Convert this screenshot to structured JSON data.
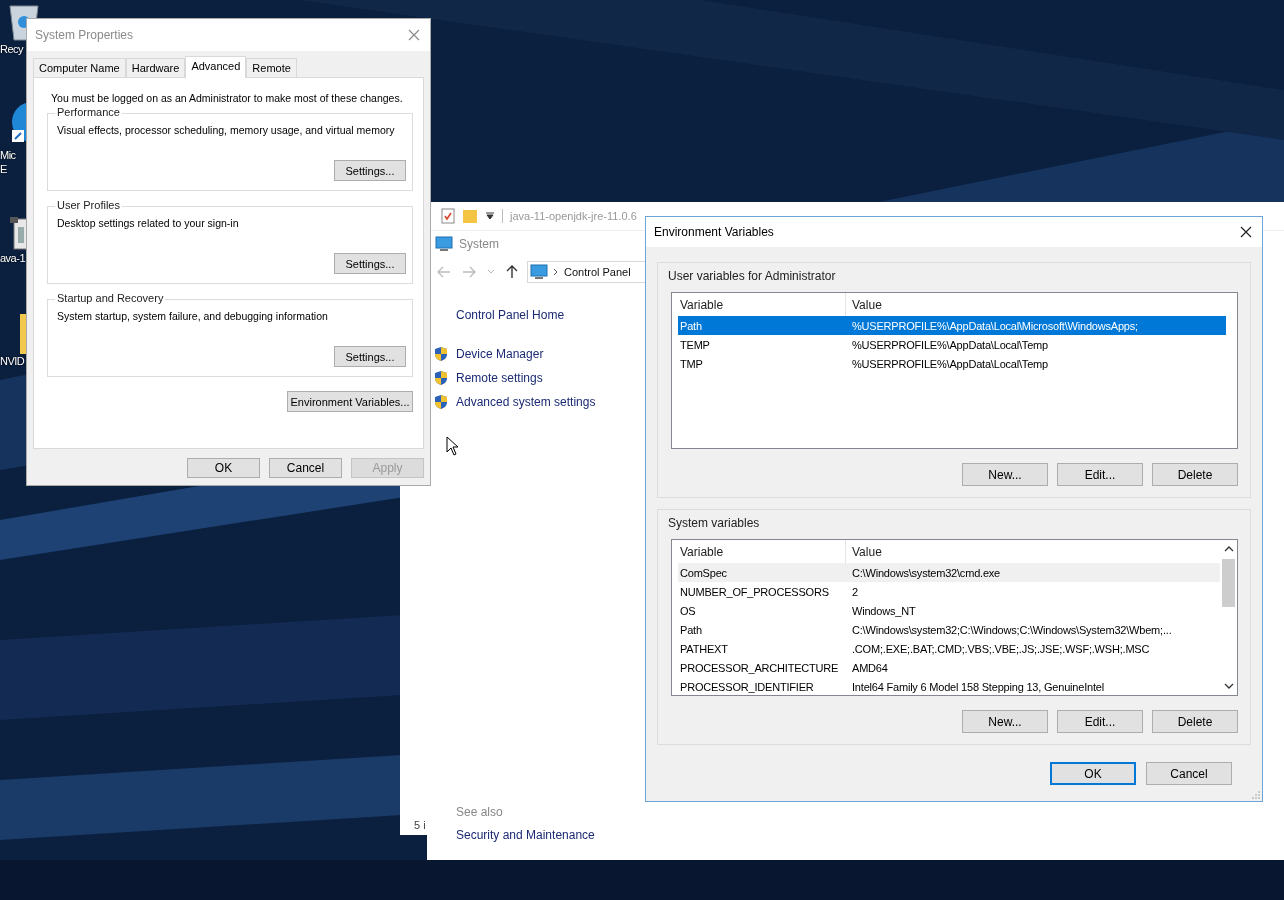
{
  "desktop": {
    "icons": [
      {
        "kind": "recycle",
        "lines": [
          "Recy"
        ]
      },
      {
        "kind": "browser",
        "lines": [
          "Mic",
          "E"
        ]
      },
      {
        "kind": "archive",
        "lines": [
          "ava-1"
        ]
      },
      {
        "kind": "folder",
        "lines": [
          "NVID"
        ]
      }
    ]
  },
  "back_window": {
    "status": "5 i"
  },
  "explorer": {
    "title": "java-11-openjdk-jre-11.0.6",
    "window_title": "System",
    "breadcrumb": "Control Panel",
    "home_link": "Control Panel Home",
    "links": [
      "Device Manager",
      "Remote settings",
      "Advanced system settings"
    ],
    "see_also": "See also",
    "see_also_links": [
      "Security and Maintenance"
    ]
  },
  "system_properties": {
    "title": "System Properties",
    "tabs": [
      {
        "label": "Computer Name",
        "selected": false
      },
      {
        "label": "Hardware",
        "selected": false
      },
      {
        "label": "Advanced",
        "selected": true
      },
      {
        "label": "Remote",
        "selected": false
      }
    ],
    "notice": "You must be logged on as an Administrator to make most of these changes.",
    "groups": [
      {
        "title": "Performance",
        "description": "Visual effects, processor scheduling, memory usage, and virtual memory",
        "button": "Settings..."
      },
      {
        "title": "User Profiles",
        "description": "Desktop settings related to your sign-in",
        "button": "Settings..."
      },
      {
        "title": "Startup and Recovery",
        "description": "System startup, system failure, and debugging information",
        "button": "Settings..."
      }
    ],
    "env_button": "Environment Variables...",
    "buttons": [
      {
        "label": "OK",
        "disabled": false
      },
      {
        "label": "Cancel",
        "disabled": false
      },
      {
        "label": "Apply",
        "disabled": true
      }
    ]
  },
  "environment_variables": {
    "title": "Environment Variables",
    "sections": [
      {
        "title": "User variables for Administrator",
        "focused": true,
        "scrollbar": false,
        "columns": [
          "Variable",
          "Value"
        ],
        "rows": [
          {
            "variable": "Path",
            "value": "%USERPROFILE%\\AppData\\Local\\Microsoft\\WindowsApps;",
            "selected": true
          },
          {
            "variable": "TEMP",
            "value": "%USERPROFILE%\\AppData\\Local\\Temp",
            "selected": false
          },
          {
            "variable": "TMP",
            "value": "%USERPROFILE%\\AppData\\Local\\Temp",
            "selected": false
          }
        ],
        "buttons": [
          "New...",
          "Edit...",
          "Delete"
        ]
      },
      {
        "title": "System variables",
        "focused": false,
        "scrollbar": true,
        "columns": [
          "Variable",
          "Value"
        ],
        "rows": [
          {
            "variable": "ComSpec",
            "value": "C:\\Windows\\system32\\cmd.exe",
            "selected": true
          },
          {
            "variable": "NUMBER_OF_PROCESSORS",
            "value": "2",
            "selected": false
          },
          {
            "variable": "OS",
            "value": "Windows_NT",
            "selected": false
          },
          {
            "variable": "Path",
            "value": "C:\\Windows\\system32;C:\\Windows;C:\\Windows\\System32\\Wbem;...",
            "selected": false
          },
          {
            "variable": "PATHEXT",
            "value": ".COM;.EXE;.BAT;.CMD;.VBS;.VBE;.JS;.JSE;.WSF;.WSH;.MSC",
            "selected": false
          },
          {
            "variable": "PROCESSOR_ARCHITECTURE",
            "value": "AMD64",
            "selected": false
          },
          {
            "variable": "PROCESSOR_IDENTIFIER",
            "value": "Intel64 Family 6 Model 158 Stepping 13, GenuineIntel",
            "selected": false
          }
        ],
        "buttons": [
          "New...",
          "Edit...",
          "Delete"
        ]
      }
    ],
    "buttons": [
      {
        "label": "OK",
        "default": true
      },
      {
        "label": "Cancel",
        "default": false
      }
    ]
  }
}
